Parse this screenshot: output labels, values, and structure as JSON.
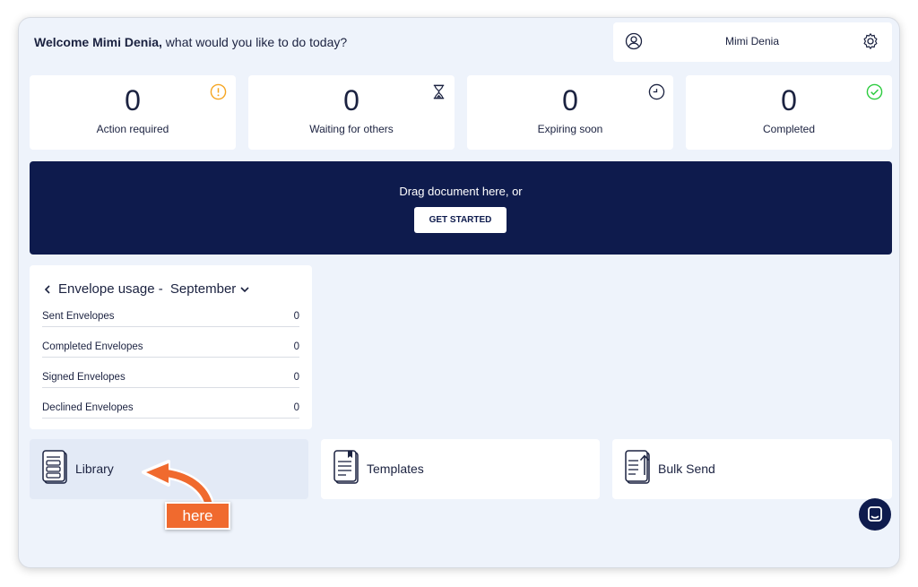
{
  "header": {
    "welcome_bold": "Welcome Mimi Denia,",
    "welcome_rest": " what would you like to do today?"
  },
  "user": {
    "name": "Mimi Denia",
    "user_icon": "user-circle-icon",
    "settings_icon": "gear-icon"
  },
  "stats": [
    {
      "value": "0",
      "label": "Action required",
      "icon": "alert-circle-icon",
      "color": "#f5a623"
    },
    {
      "value": "0",
      "label": "Waiting for others",
      "icon": "hourglass-icon",
      "color": "#1b2240"
    },
    {
      "value": "0",
      "label": "Expiring soon",
      "icon": "clock-icon",
      "color": "#1b2240"
    },
    {
      "value": "0",
      "label": "Completed",
      "icon": "check-circle-icon",
      "color": "#2ecc40"
    }
  ],
  "dropzone": {
    "text": "Drag document here, or",
    "button": "GET STARTED",
    "bg_color": "#0e1b4d"
  },
  "usage": {
    "title": "Envelope usage - ",
    "month": "September",
    "rows": [
      {
        "label": "Sent Envelopes",
        "value": "0"
      },
      {
        "label": "Completed Envelopes",
        "value": "0"
      },
      {
        "label": "Signed Envelopes",
        "value": "0"
      },
      {
        "label": "Declined Envelopes",
        "value": "0"
      }
    ]
  },
  "tiles": [
    {
      "label": "Library",
      "icon": "library-icon"
    },
    {
      "label": "Templates",
      "icon": "template-icon"
    },
    {
      "label": "Bulk Send",
      "icon": "bulk-send-icon"
    }
  ],
  "annotation": {
    "text": "here",
    "color": "#f06a2e"
  },
  "chat": {
    "icon": "chat-icon"
  }
}
